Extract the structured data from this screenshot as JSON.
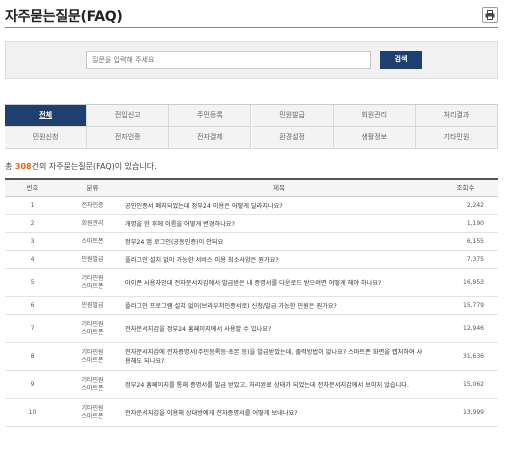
{
  "page": {
    "title": "자주묻는질문(FAQ)"
  },
  "search": {
    "placeholder": "질문을 입력해 주세요",
    "button_label": "검색"
  },
  "categories": [
    "전체",
    "전입신고",
    "주민등록",
    "민원발급",
    "회원관리",
    "처리결과",
    "민원신청",
    "전자인증",
    "전자결제",
    "환경설정",
    "생활정보",
    "기타민원"
  ],
  "active_category": "전체",
  "summary": {
    "prefix": "총 ",
    "count": "308",
    "suffix": "건의 자주묻는질문(FAQ)이 있습니다."
  },
  "table": {
    "headers": {
      "no": "번호",
      "category": "분류",
      "subject": "제목",
      "views": "조회수"
    },
    "rows": [
      {
        "no": "1",
        "category": "전자인증",
        "subject": "공인인증서 폐지되었는데 정부24 이용은 어떻게 달라지나요?",
        "views": "2,242"
      },
      {
        "no": "2",
        "category": "회원관리",
        "subject": "개명을 한 후에 이름을 어떻게 변경하나요?",
        "views": "1,190"
      },
      {
        "no": "3",
        "category": "스마트폰",
        "subject": "정부24 앱 로그인(공동인증)이 안되요",
        "views": "6,155"
      },
      {
        "no": "4",
        "category": "민원발급",
        "subject": "플러그인 설치 없이 가능한 서비스 이용 최소사양은 뭔가요?",
        "views": "7,375"
      },
      {
        "no": "5",
        "category": "기타민원\n스마트폰",
        "subject": "아이폰 사용자인데 전자문서지갑에서 발급받은 내 증명서를 다운로드 받으려면 어떻게 해야 하나요?",
        "views": "16,953"
      },
      {
        "no": "6",
        "category": "민원발급",
        "subject": "플러그인 프로그램 설치 없이(브라우저인증서로) 신청/발급 가능한 민원은 뭔가요?",
        "views": "15,779"
      },
      {
        "no": "7",
        "category": "기타민원\n스마트폰",
        "subject": "전자문서지갑을 정부24 홈페이지에서 사용할 수 있나요?",
        "views": "12,946"
      },
      {
        "no": "8",
        "category": "기타민원\n스마트폰",
        "subject": "전자문서지갑에 전자증명서(주민등록등·초본 등)을 발급받았는데, 출력방법이 없나요? 스마트폰 화면을 캡처하여 사용해도 되나요?",
        "views": "31,636"
      },
      {
        "no": "9",
        "category": "기타민원\n스마트폰",
        "subject": "정부24 홈페이지를 통해 증명서를 발급 받았고, 처리완료 상태가 되었는데 전자문서지갑에서 보이지 않습니다.",
        "views": "15,062"
      },
      {
        "no": "10",
        "category": "기타민원\n스마트폰",
        "subject": "전자문서지갑을 이용해 상대방에게 전자증명서를 어떻게 보내나요?",
        "views": "13,999"
      }
    ]
  },
  "icons": {
    "print": "printer-icon"
  },
  "colors": {
    "accent": "#1f3f6e",
    "count_highlight": "#e2641e"
  }
}
